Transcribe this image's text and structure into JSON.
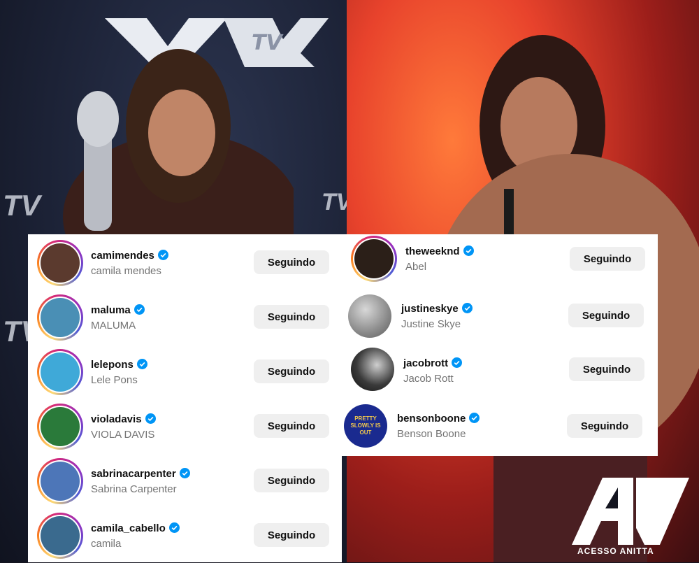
{
  "background": {
    "left_logo_text": "VMA",
    "side_logo_text": "TV"
  },
  "follow_list_left": [
    {
      "username": "camimendes",
      "name": "camila mendes",
      "button": "Seguindo",
      "verified": true,
      "avatar_color": "#5b3a2e"
    },
    {
      "username": "maluma",
      "name": "MALUMA",
      "button": "Seguindo",
      "verified": true,
      "avatar_color": "#4a8fb5"
    },
    {
      "username": "lelepons",
      "name": "Lele Pons",
      "button": "Seguindo",
      "verified": true,
      "avatar_color": "#3fa9d8"
    },
    {
      "username": "violadavis",
      "name": "VIOLA DAVIS",
      "button": "Seguindo",
      "verified": true,
      "avatar_color": "#2a7a3a"
    },
    {
      "username": "sabrinacarpenter",
      "name": "Sabrina Carpenter",
      "button": "Seguindo",
      "verified": true,
      "avatar_color": "#4d76b8"
    },
    {
      "username": "camila_cabello",
      "name": "camila",
      "button": "Seguindo",
      "verified": true,
      "avatar_color": "#3a6a8e"
    }
  ],
  "follow_list_right": [
    {
      "username": "theweeknd",
      "name": "Abel",
      "button": "Seguindo",
      "verified": true,
      "avatar_color": "#2b1f18"
    },
    {
      "username": "justineskye",
      "name": "Justine Skye",
      "button": "Seguindo",
      "verified": true,
      "avatar_color": "#9a9a9a"
    },
    {
      "username": "jacobrott",
      "name": "Jacob Rott",
      "button": "Seguindo",
      "verified": true,
      "avatar_color": "#3a3a3a"
    },
    {
      "username": "bensonboone",
      "name": "Benson Boone",
      "button": "Seguindo",
      "verified": true,
      "avatar_color": "#1a2a8f",
      "avatar_text": "PRETTY SLOWLY IS OUT"
    }
  ],
  "brand": {
    "logo_letters": "AA",
    "name": "ACESSO ANITTA"
  },
  "colors": {
    "verified_badge": "#0095f6",
    "button_bg": "#efefef",
    "story_ring": [
      "#feda75",
      "#fa7e1e",
      "#d62976",
      "#962fbf",
      "#4f5bd5"
    ]
  }
}
